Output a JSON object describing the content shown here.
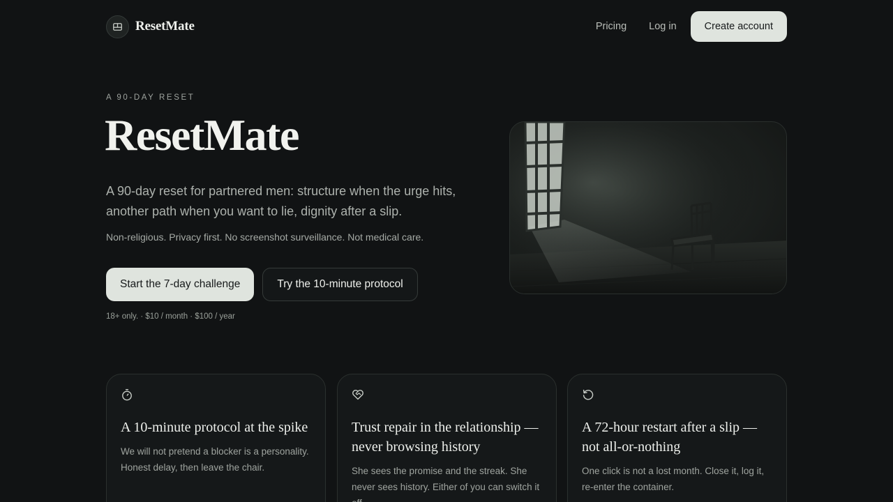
{
  "header": {
    "brand_name": "ResetMate",
    "nav_pricing": "Pricing",
    "nav_login": "Log in",
    "create_account": "Create account"
  },
  "hero": {
    "eyebrow": "A 90-DAY RESET",
    "title": "ResetMate",
    "subtitle": "A 90-day reset for partnered men: structure when the urge hits, another path when you want to lie, dignity after a slip.",
    "note": "Non-religious. Privacy first. No screenshot surveillance. Not medical care.",
    "primary_cta": "Start the 7-day challenge",
    "secondary_cta": "Try the 10-minute protocol",
    "pricing_note": "18+ only. · $10 / month · $100 / year"
  },
  "features": [
    {
      "icon": "stopwatch-icon",
      "title": "A 10-minute protocol at the spike",
      "body": "We will not pretend a blocker is a personality. Honest delay, then leave the chair."
    },
    {
      "icon": "heart-handshake-icon",
      "title": "Trust repair in the relationship — never browsing history",
      "body": "She sees the promise and the streak. She never sees history. Either of you can switch it off."
    },
    {
      "icon": "restart-icon",
      "title": "A 72-hour restart after a slip — not all-or-nothing",
      "body": "One click is not a lost month. Close it, log it, re-enter the container."
    }
  ],
  "colors": {
    "background": "#111314",
    "accent_button": "#dfe4de",
    "text_primary": "#eef0ec",
    "text_muted": "#9fa49f"
  }
}
